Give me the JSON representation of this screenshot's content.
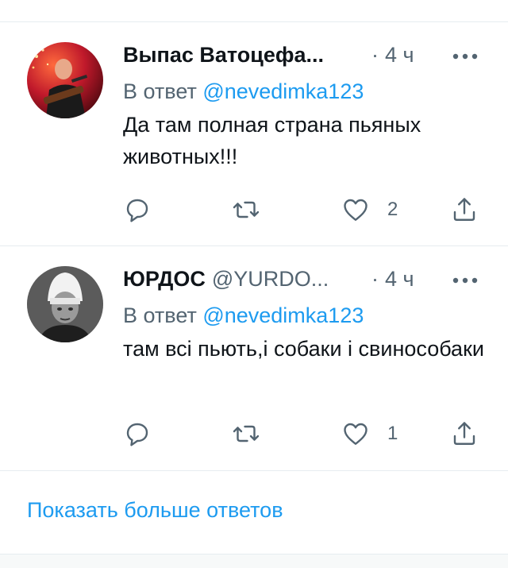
{
  "tweets": [
    {
      "display_name": "Выпас Ватоцефа...",
      "handle": "",
      "dot": "·",
      "time": "4 ч",
      "reply_prefix": "В ответ ",
      "reply_mention": "@nevedimka123",
      "text": "Да там полная страна пьяных животных!!!",
      "reply_count": "",
      "retweet_count": "",
      "like_count": "2"
    },
    {
      "display_name": "ЮРДОС",
      "handle": "@YURDO...",
      "dot": "·",
      "time": "4 ч",
      "reply_prefix": "В ответ ",
      "reply_mention": "@nevedimka123",
      "text": "там всі пьють,і собаки і свинособаки",
      "reply_count": "",
      "retweet_count": "",
      "like_count": "1"
    }
  ],
  "show_more_label": "Показать больше ответов",
  "colors": {
    "accent": "#1d9bf0",
    "secondary_text": "#536471",
    "primary_text": "#0f1419",
    "divider": "#e6ecf0"
  },
  "icons": [
    "more-icon",
    "reply-icon",
    "retweet-icon",
    "like-icon",
    "share-icon"
  ]
}
